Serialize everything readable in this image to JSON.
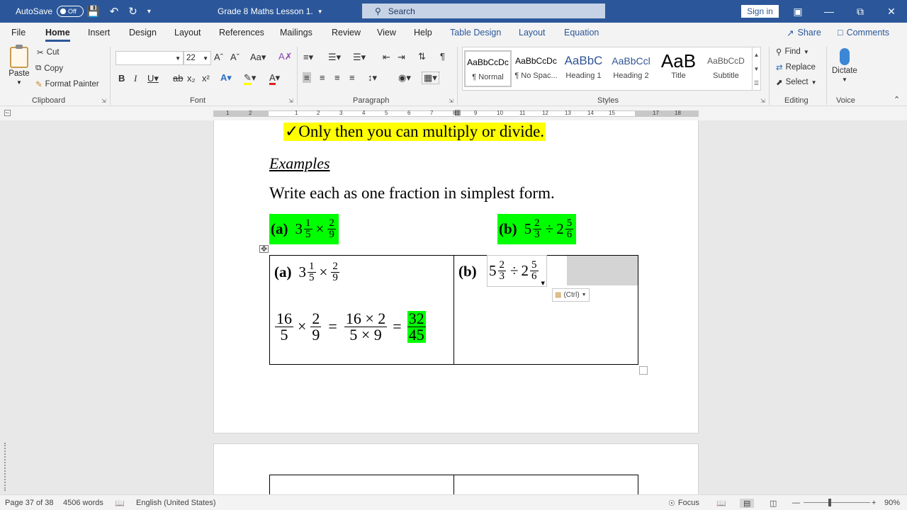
{
  "titlebar": {
    "autosave_label": "AutoSave",
    "autosave_state": "Off",
    "document_title": "Grade 8 Maths Lesson 1.",
    "search_placeholder": "Search",
    "signin_label": "Sign in"
  },
  "tabs": [
    "File",
    "Home",
    "Insert",
    "Design",
    "Layout",
    "References",
    "Mailings",
    "Review",
    "View",
    "Help",
    "Table Design",
    "Layout",
    "Equation"
  ],
  "active_tab": "Home",
  "right_tabs": {
    "share": "Share",
    "comments": "Comments"
  },
  "ribbon": {
    "clipboard": {
      "paste": "Paste",
      "cut": "Cut",
      "copy": "Copy",
      "format_painter": "Format Painter",
      "label": "Clipboard"
    },
    "font": {
      "font_name": "",
      "font_size": "22",
      "label": "Font"
    },
    "paragraph": {
      "label": "Paragraph"
    },
    "styles": {
      "label": "Styles",
      "items": [
        {
          "preview": "AaBbCcDc",
          "name": "¶ Normal"
        },
        {
          "preview": "AaBbCcDc",
          "name": "¶ No Spac..."
        },
        {
          "preview": "AaBbC",
          "name": "Heading 1"
        },
        {
          "preview": "AaBbCcl",
          "name": "Heading 2"
        },
        {
          "preview": "AaB",
          "name": "Title"
        },
        {
          "preview": "AaBbCcD",
          "name": "Subtitle"
        }
      ]
    },
    "editing": {
      "find": "Find",
      "replace": "Replace",
      "select": "Select",
      "label": "Editing"
    },
    "voice": {
      "dictate": "Dictate",
      "label": "Voice"
    }
  },
  "ruler": {
    "numbers": [
      "1",
      "2",
      "1",
      "2",
      "3",
      "4",
      "5",
      "6",
      "7",
      "8",
      "9",
      "10",
      "11",
      "12",
      "13",
      "14",
      "15",
      "17",
      "18"
    ]
  },
  "document": {
    "check_line": "✓Only then you can multiply or divide.",
    "examples_heading": "Examples",
    "instruction": "Write each as one fraction in simplest form.",
    "example_a": {
      "label": "(a)",
      "whole": "3",
      "n1": "1",
      "d1": "5",
      "op": "×",
      "n2": "2",
      "d2": "9"
    },
    "example_b": {
      "label": "(b)",
      "whole1": "5",
      "n1": "2",
      "d1": "3",
      "op": "÷",
      "whole2": "2",
      "n2": "5",
      "d2": "6"
    },
    "working_a": {
      "f1n": "16",
      "f1d": "5",
      "times": "×",
      "f2n": "2",
      "f2d": "9",
      "eq": "=",
      "f3n": "16 × 2",
      "f3d": "5 × 9",
      "eq2": "=",
      "ansn": "32",
      "ansd": "45"
    },
    "paste_options": "(Ctrl)"
  },
  "statusbar": {
    "page": "Page 37 of 38",
    "words": "4506 words",
    "language": "English (United States)",
    "focus": "Focus",
    "zoom": "90%"
  },
  "colors": {
    "accent": "#2b579a",
    "highlight_yellow": "#ffff00",
    "highlight_green": "#00ff00"
  }
}
